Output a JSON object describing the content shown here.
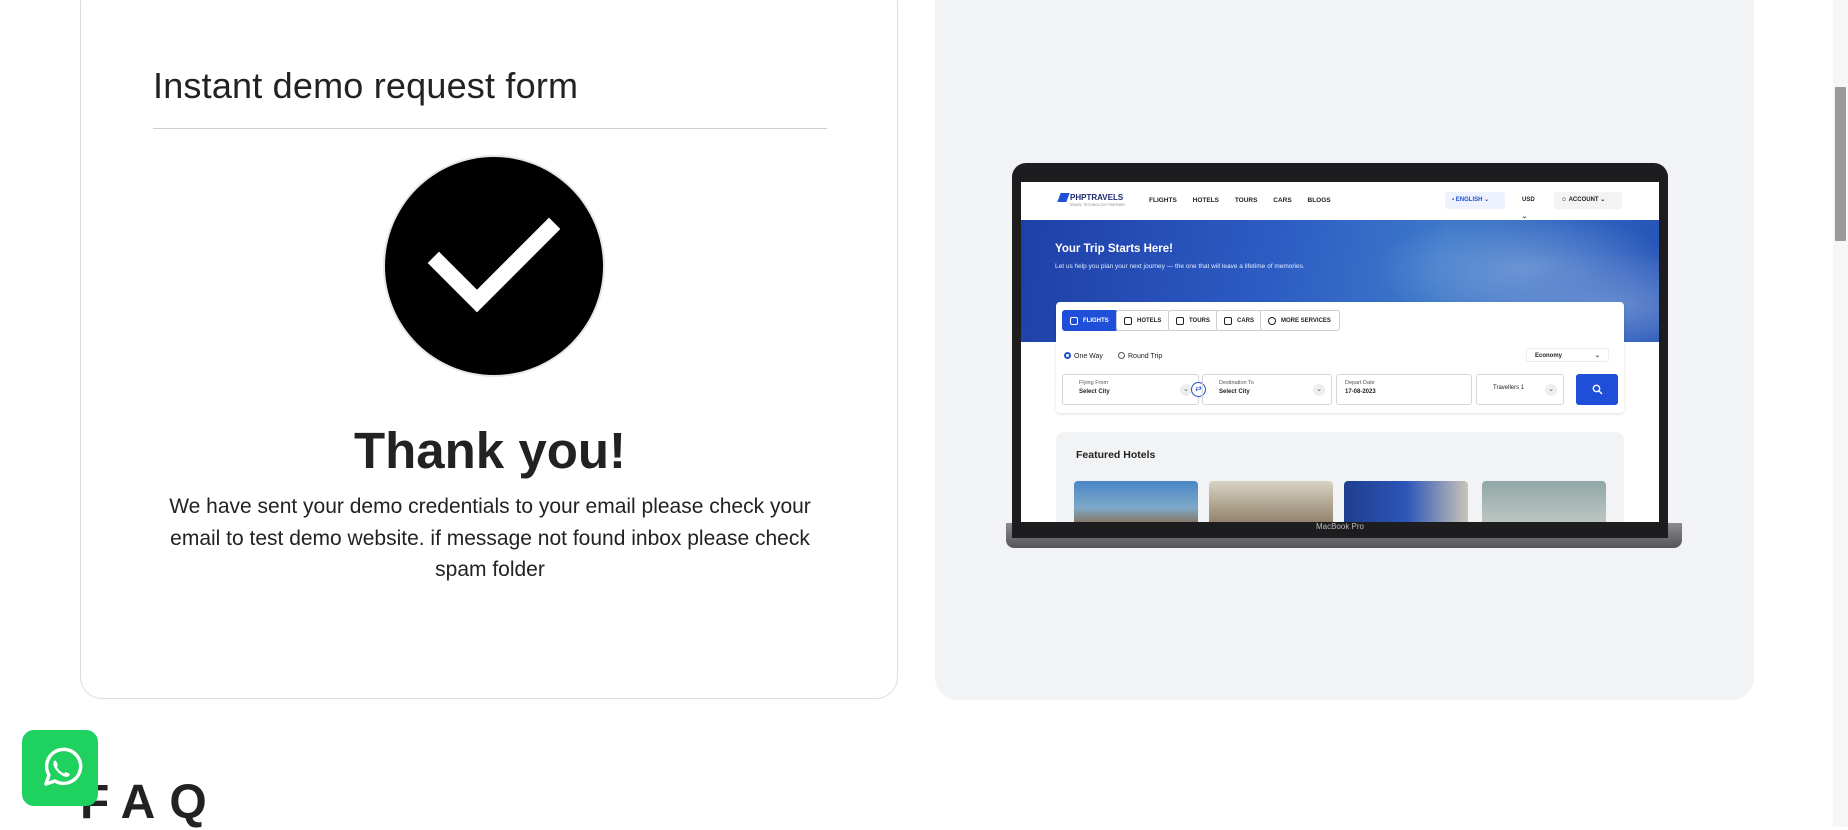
{
  "form": {
    "title": "Instant demo request form",
    "success_heading": "Thank you!",
    "success_message": "We have sent your demo credentials to your email please check your email to test demo website. if message not found inbox please check spam folder"
  },
  "preview": {
    "device_label": "MacBook Pro",
    "site": {
      "logo": "PHPTRAVELS",
      "logo_tagline": "TRAVEL TECHNOLOGY PARTNER",
      "nav": [
        "FLIGHTS",
        "HOTELS",
        "TOURS",
        "CARS",
        "BLOGS"
      ],
      "language": "ENGLISH",
      "currency": "USD",
      "account": "ACCOUNT",
      "hero_title": "Your Trip Starts Here!",
      "hero_subtitle": "Let us help you plan your next journey — the one that will leave a lifetime of memories.",
      "tabs": [
        "FLIGHTS",
        "HOTELS",
        "TOURS",
        "CARS",
        "MORE SERVICES"
      ],
      "trip_types": [
        "One Way",
        "Round Trip"
      ],
      "cabin_class": "Economy",
      "flying_from_label": "Flying From",
      "flying_from_value": "Select City",
      "destination_label": "Destination To",
      "destination_value": "Select City",
      "depart_label": "Depart Date",
      "depart_value": "17-08-2023",
      "travellers_label": "Travellers 1",
      "featured_title": "Featured Hotels"
    }
  },
  "faq": {
    "title": "FAQ"
  },
  "colors": {
    "accent": "#1f4ed8",
    "whatsapp": "#1fd15f",
    "panel_bg": "#f2f3f4"
  }
}
